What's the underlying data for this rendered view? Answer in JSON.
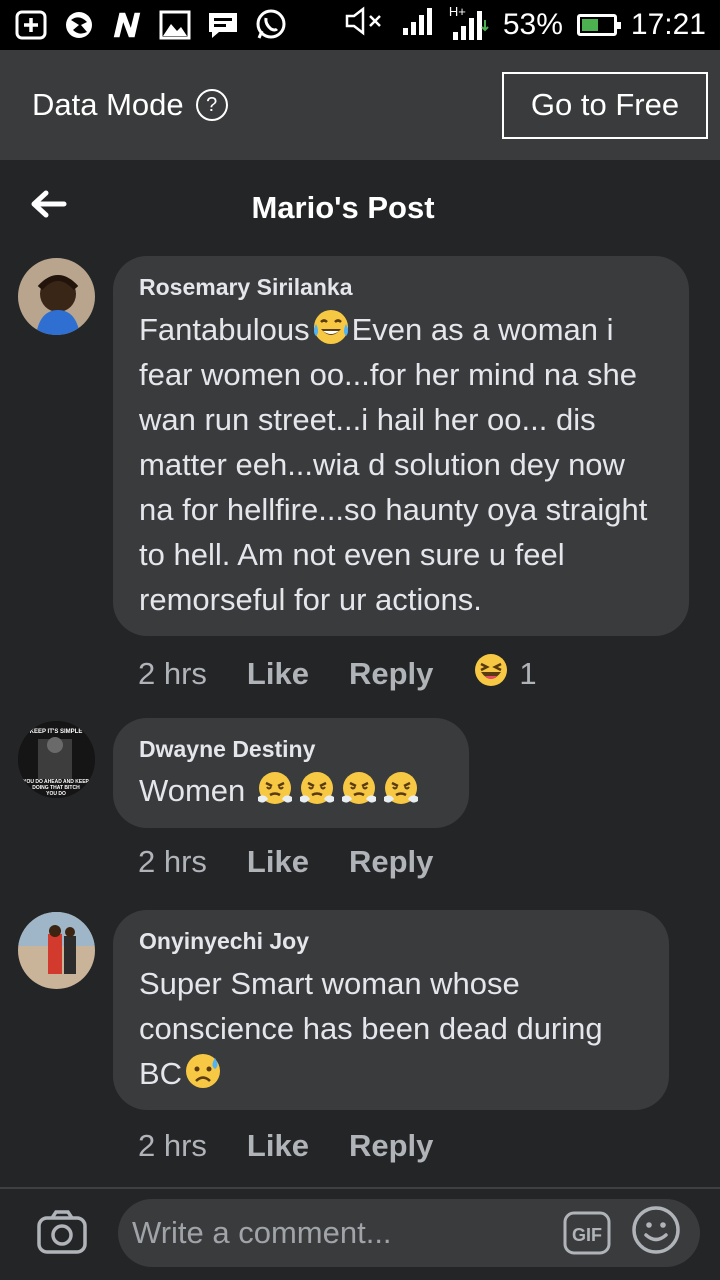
{
  "status_bar": {
    "icons": [
      "add-icon",
      "app-icon",
      "n-icon",
      "gallery-icon",
      "message-icon",
      "whatsapp-icon",
      "mute-icon",
      "signal-icon",
      "hplus-signal-icon"
    ],
    "network_label": "H+",
    "battery": "53%",
    "battery_level": 0.53,
    "time": "17:21"
  },
  "data_mode": {
    "label": "Data Mode",
    "button": "Go to Free"
  },
  "header": {
    "title": "Mario's Post"
  },
  "comments": [
    {
      "author": "Rosemary Sirilanka",
      "text_parts": [
        "Fantabulous",
        "Even as a woman i fear women oo...for her mind na she wan run street...i hail her oo... dis matter eeh...wia d solution dey now na for hellfire...so haunty oya straight to hell. Am not even sure u feel remorseful for ur actions."
      ],
      "emoji": "tears-of-joy",
      "time": "2 hrs",
      "like": "Like",
      "reply": "Reply",
      "reaction": "haha",
      "reaction_count": "1"
    },
    {
      "author": "Dwayne Destiny",
      "text": "Women",
      "emoji": "steam-face",
      "emoji_count": 4,
      "time": "2 hrs",
      "like": "Like",
      "reply": "Reply",
      "avatar_text": [
        "KEEP IT'S SIMPLE",
        "YOU DO AHEAD AND KEEP",
        "DOING THAT BITCH",
        "YOU DO"
      ]
    },
    {
      "author": "Onyinyechi Joy",
      "text": "Super Smart woman whose conscience has been dead during BC",
      "emoji": "sad-sweat-face",
      "time": "2 hrs",
      "like": "Like",
      "reply": "Reply"
    }
  ],
  "composer": {
    "placeholder": "Write a comment...",
    "gif_label": "GIF"
  },
  "colors": {
    "background": "#242526",
    "bubble": "#3a3b3c",
    "text": "#e4e6eb",
    "muted": "#b0b3b8",
    "battery": "#4caf50"
  }
}
